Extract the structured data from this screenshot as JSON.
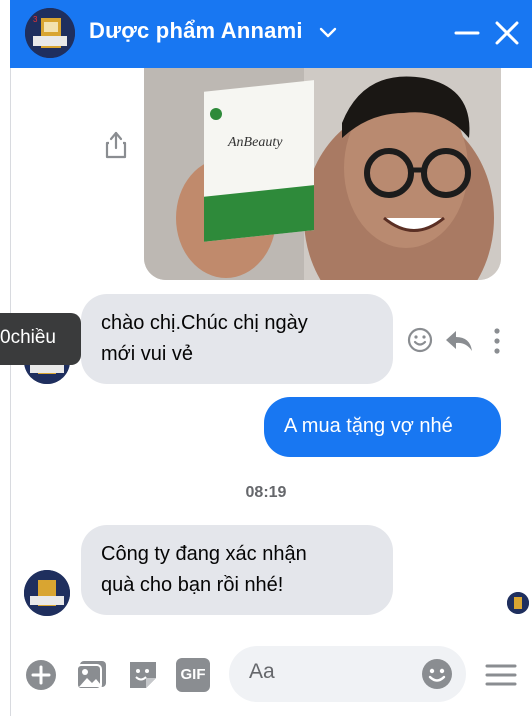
{
  "header": {
    "title": "Dược phẩm Annami",
    "bg_color": "#1877F2"
  },
  "messages": {
    "m1": {
      "line1": "chào chị.Chúc chị ngày",
      "line2": "mới vui vẻ"
    },
    "m2": {
      "text": "A mua tặng vợ nhé"
    },
    "m3": {
      "line1": "Công ty đang xác nhận",
      "line2": "quà cho bạn rồi nhé!"
    },
    "tooltip": "0chiều",
    "timestamp": "08:19"
  },
  "photo": {
    "product_label": "AnBeauty"
  },
  "composer": {
    "placeholder": "Aa",
    "gif_label": "GIF"
  },
  "icons": [
    "chevron-down-icon",
    "minimize-icon",
    "close-icon",
    "share-icon",
    "smile-icon",
    "reply-icon",
    "more-icon",
    "plus-icon",
    "image-icon",
    "sticker-icon",
    "gif-icon",
    "emoji-icon",
    "menu-icon"
  ]
}
